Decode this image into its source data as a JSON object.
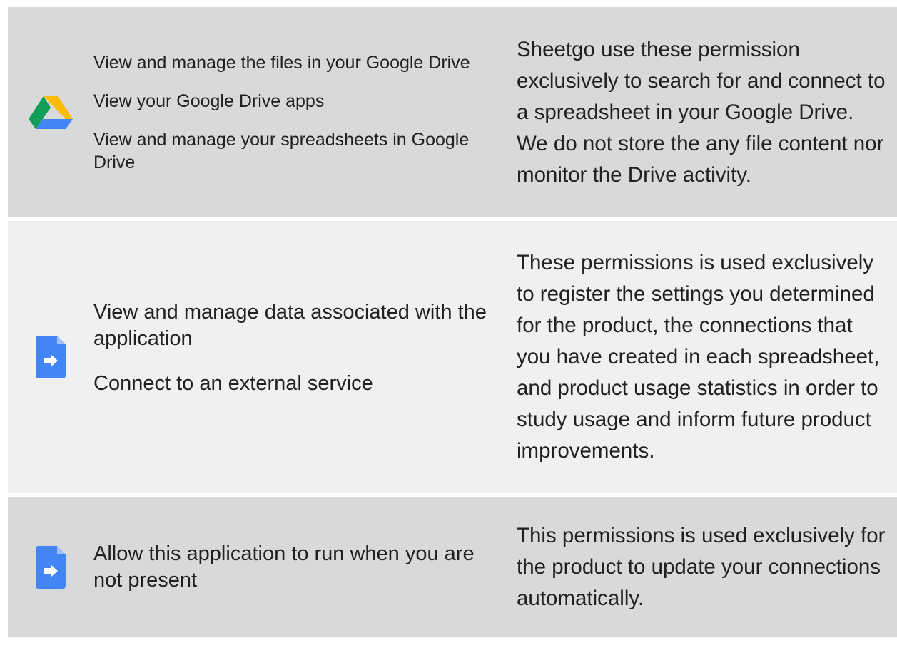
{
  "permissions": [
    {
      "icon": "google-drive-icon",
      "items": [
        "View and manage the files in your Google Drive",
        "View your Google Drive apps",
        "View and manage your spreadsheets in Google Drive"
      ],
      "description": "Sheetgo use these permission exclusively to search for and connect to a spreadsheet in your Google Drive. We do not store the any file content nor monitor the Drive activity."
    },
    {
      "icon": "apps-script-file-icon",
      "items": [
        "View and manage data associated with the application",
        "Connect to an external service"
      ],
      "description": "These permissions is used exclusively to register the settings you determined for the product, the connections that you have created in each spreadsheet, and product usage statistics in order to study usage and inform future product improvements."
    },
    {
      "icon": "apps-script-file-icon",
      "items": [
        "Allow this application to run when you are not present"
      ],
      "description": "This permissions is used exclusively for the product to update your connections automatically."
    }
  ],
  "colors": {
    "row_shaded": "#d9d9d9",
    "row_light": "#f0f0f0",
    "file_icon_blue": "#4285f4"
  }
}
